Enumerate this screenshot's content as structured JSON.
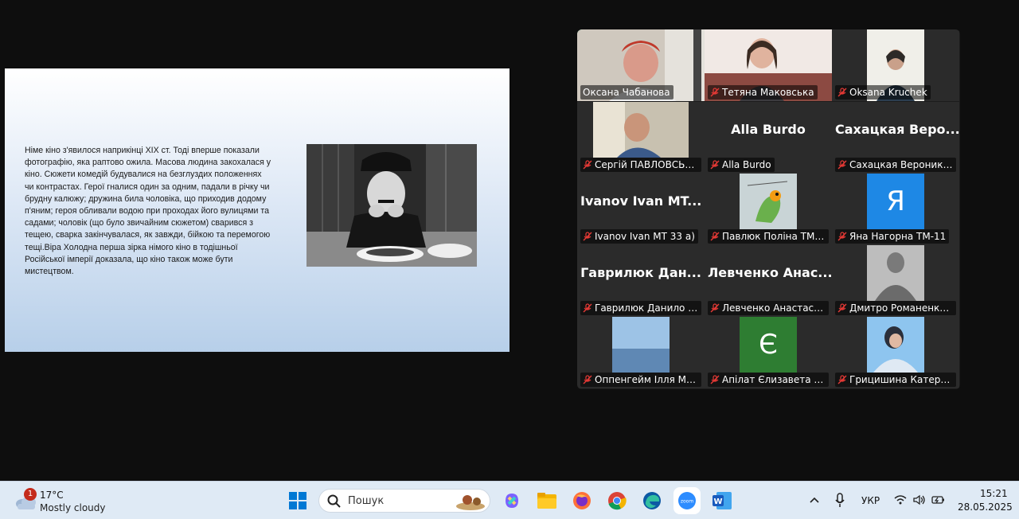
{
  "slide": {
    "text": "Німе кіно з'явилося наприкінці XIX ст. Тоді вперше показали фотографію, яка раптово ожила. Масова людина закохалася у кіно. Сюжети комедій будувалися на безглуздих положеннях чи контрастах. Герої гналися один за одним, падали в річку чи брудну калюжу; дружина била чоловіка, що приходив додому п'яним; героя обливали водою при проходах його вулицями та садами; чоловік (що було звичайним сюжетом) сварився з тещею, сварка закінчувалася, як завжди, бійкою та перемогою тещі.Віра Холодна  перша зірка німого кіно в  тодішньої Російської імперії доказала, що кіно також може бути мистецтвом."
  },
  "participants": [
    {
      "name": "Оксана Чабанова",
      "label": "Оксана Чабанова",
      "type": "video",
      "muted": false,
      "active": true
    },
    {
      "name": "Тетяна Маковська",
      "label": "Тетяна Маковська",
      "type": "video",
      "muted": true
    },
    {
      "name": "Oksana Kruchek",
      "label": "Oksana Kruchek",
      "type": "video",
      "muted": true
    },
    {
      "name": "Сергій ПАВЛОВСЬКИЙ",
      "label": "Сергій ПАВЛОВСЬКИЙ",
      "type": "photo",
      "muted": true
    },
    {
      "name": "Alla Burdo",
      "label": "Alla Burdo",
      "type": "name",
      "muted": true
    },
    {
      "name": "Сахацкая  Веро...",
      "label": "Сахацкая Вероника Т...",
      "type": "name",
      "muted": true
    },
    {
      "name": "Ivanov  Ivan  MT...",
      "label": "Ivanov Ivan MT 33 a)",
      "type": "name",
      "muted": true
    },
    {
      "name": "Павлюк Поліна ТМ-25",
      "label": "Павлюк Поліна ТМ-25",
      "type": "photo",
      "muted": true
    },
    {
      "name": "Яна Нагорна ТМ-11",
      "label": "Яна Нагорна ТМ-11",
      "type": "letter",
      "letter": "Я",
      "color": "#1e88e5",
      "muted": true
    },
    {
      "name": "Гаврилюк  Дан...",
      "label": "Гаврилюк Данило ТМ...",
      "type": "name",
      "muted": true
    },
    {
      "name": "Левченко  Анас...",
      "label": "Левченко Анастасия ...",
      "type": "name",
      "muted": true
    },
    {
      "name": "Дмитро Романенко Г...",
      "label": "Дмитро Романенко Г...",
      "type": "photo",
      "muted": true
    },
    {
      "name": "Оппенгейм Ілля МТс-...",
      "label": "Оппенгейм Ілля МТс-...",
      "type": "photo",
      "muted": true
    },
    {
      "name": "Апілат Єлизавета МТ-...",
      "label": "Апілат Єлизавета МТ-...",
      "type": "letter",
      "letter": "Є",
      "color": "#2e7d32",
      "muted": true
    },
    {
      "name": "Грицишина Катерина...",
      "label": "Грицишина Катерина...",
      "type": "photo",
      "muted": true
    }
  ],
  "taskbar": {
    "weather_temp": "17°C",
    "weather_desc": "Mostly cloudy",
    "notification_count": "1",
    "search_placeholder": "Пошук",
    "language": "УКР",
    "time": "15:21",
    "date": "28.05.2025",
    "pinned": [
      "start-icon",
      "copilot-icon",
      "file-explorer-icon",
      "firefox-icon",
      "chrome-icon",
      "edge-icon",
      "zoom-icon",
      "word-icon"
    ]
  }
}
